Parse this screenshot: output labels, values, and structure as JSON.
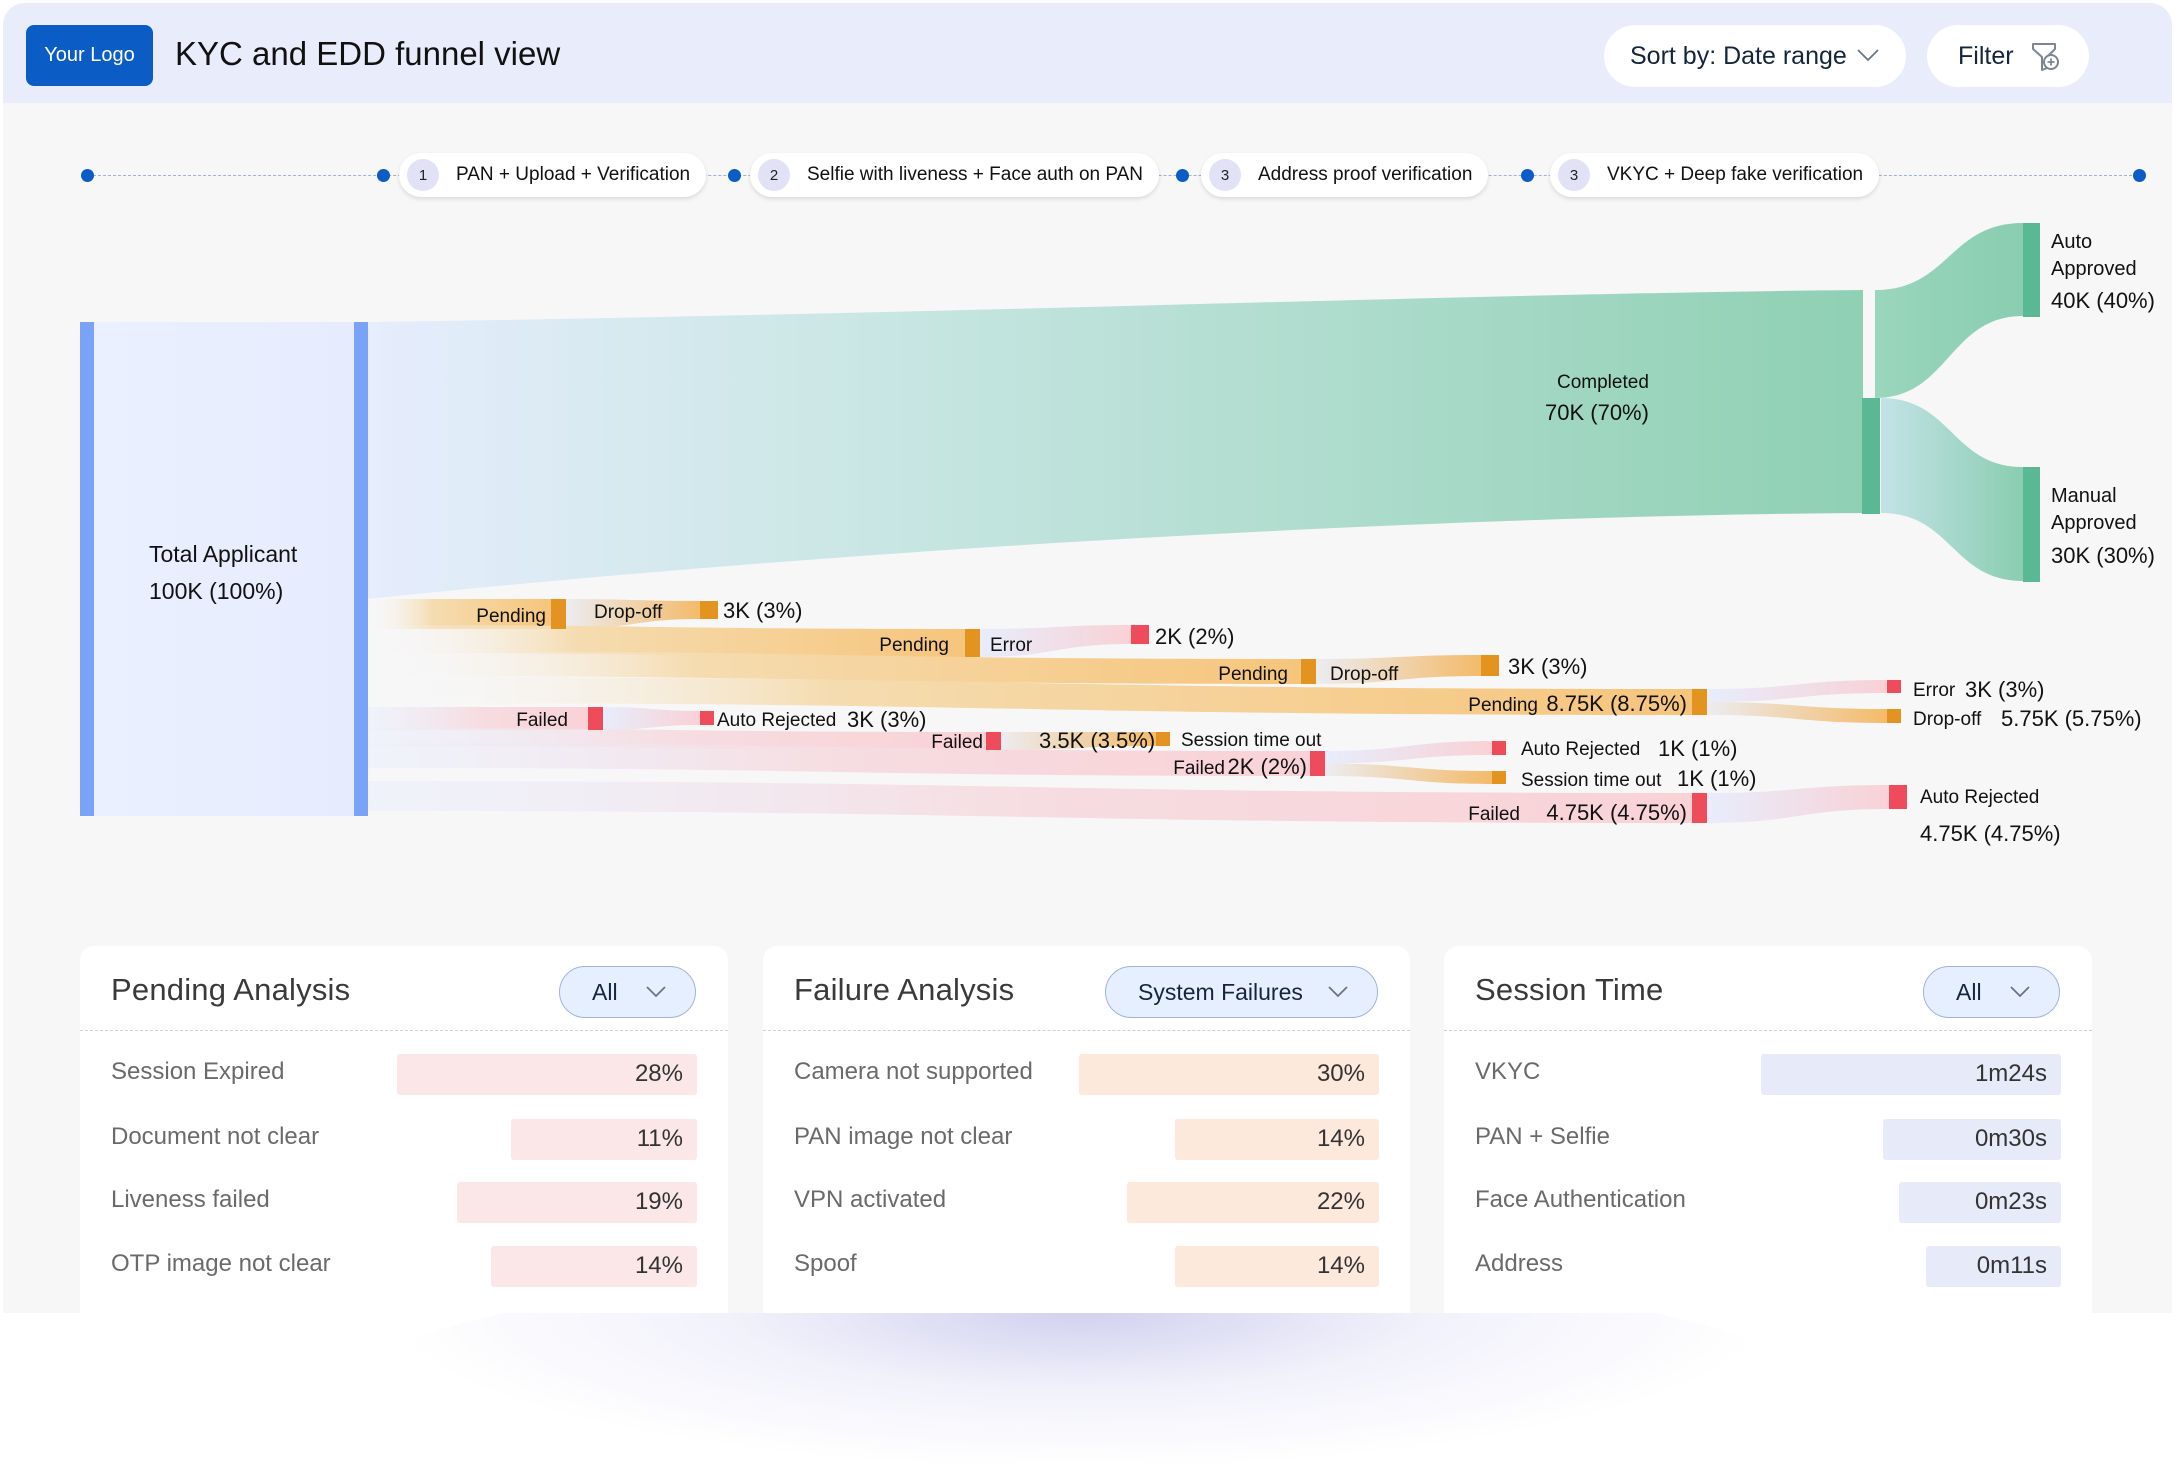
{
  "header": {
    "logo_text": "Your Logo",
    "title": "KYC and EDD funnel view",
    "sort_label": "Sort by: Date range",
    "filter_label": "Filter",
    "icons": {
      "sort": "chevron-down-icon",
      "filter": "filter-add-icon"
    }
  },
  "steps": [
    {
      "num": "1",
      "label": "PAN + Upload + Verification"
    },
    {
      "num": "2",
      "label": "Selfie with liveness + Face auth on PAN"
    },
    {
      "num": "3",
      "label": "Address proof verification"
    },
    {
      "num": "3",
      "label": "VKYC + Deep fake verification"
    }
  ],
  "colors": {
    "brand": "#0b5cc4",
    "total_node": "#7aa2f7",
    "completed": "#5bb894",
    "pending": "#e39320",
    "failed": "#ee4c5a",
    "pending_bar_bg": "#fbe7e7",
    "failure_bar_bg": "#fde8dc",
    "session_bar_bg": "#e6eaf9"
  },
  "chart_data": {
    "type": "sankey",
    "title": "KYC and EDD funnel view",
    "units": "applicants",
    "nodes": [
      {
        "id": "total",
        "label": "Total Applicant",
        "value_label": "100K (100%)",
        "value": 100000
      },
      {
        "id": "completed",
        "label": "Completed",
        "value_label": "70K (70%)",
        "value": 70000
      },
      {
        "id": "auto_approved",
        "label": "Auto Approved",
        "value_label": "40K (40%)",
        "value": 40000
      },
      {
        "id": "manual_approved",
        "label": "Manual Approved",
        "value_label": "30K (30%)",
        "value": 30000
      },
      {
        "id": "pending_s1",
        "label": "Pending",
        "stage": 1
      },
      {
        "id": "dropoff_s1",
        "label": "Drop-off",
        "value_label": "3K (3%)",
        "value": 3000
      },
      {
        "id": "pending_s2",
        "label": "Pending",
        "stage": 2
      },
      {
        "id": "error_s2",
        "label": "Error",
        "value_label": "2K (2%)",
        "value": 2000
      },
      {
        "id": "pending_s3",
        "label": "Pending",
        "stage": 3
      },
      {
        "id": "dropoff_s3",
        "label": "Drop-off",
        "value_label": "3K (3%)",
        "value": 3000
      },
      {
        "id": "pending_s4",
        "label": "Pending",
        "value_label": "8.75K (8.75%)",
        "value": 8750,
        "stage": 4
      },
      {
        "id": "error_s4",
        "label": "Error",
        "value_label": "3K (3%)",
        "value": 3000
      },
      {
        "id": "dropoff_s4",
        "label": "Drop-off",
        "value_label": "5.75K (5.75%)",
        "value": 5750
      },
      {
        "id": "failed_s1",
        "label": "Failed",
        "stage": 1
      },
      {
        "id": "autorej_s1",
        "label": "Auto Rejected",
        "value_label": "3K (3%)",
        "value": 3000
      },
      {
        "id": "failed_s2",
        "label": "Failed",
        "stage": 2
      },
      {
        "id": "timeout_s2",
        "label": "Session time out",
        "value_label": "3.5K (3.5%)",
        "value": 3500
      },
      {
        "id": "failed_s3",
        "label": "Failed",
        "value_label": "2K (2%)",
        "value": 2000,
        "stage": 3
      },
      {
        "id": "autorej_s3",
        "label": "Auto Rejected",
        "value_label": "1K (1%)",
        "value": 1000
      },
      {
        "id": "timeout_s3",
        "label": "Session time out",
        "value_label": "1K (1%)",
        "value": 1000
      },
      {
        "id": "failed_s4",
        "label": "Failed",
        "value_label": "4.75K (4.75%)",
        "value": 4750,
        "stage": 4
      },
      {
        "id": "autorej_s4",
        "label": "Auto Rejected",
        "value_label": "4.75K (4.75%)",
        "value": 4750
      }
    ],
    "links": [
      {
        "source": "total",
        "target": "completed",
        "value": 70000
      },
      {
        "source": "completed",
        "target": "auto_approved",
        "value": 40000
      },
      {
        "source": "completed",
        "target": "manual_approved",
        "value": 30000
      },
      {
        "source": "total",
        "target": "pending_s1",
        "value": 3000
      },
      {
        "source": "pending_s1",
        "target": "dropoff_s1",
        "value": 3000
      },
      {
        "source": "total",
        "target": "pending_s2",
        "value": 2000
      },
      {
        "source": "pending_s2",
        "target": "error_s2",
        "value": 2000
      },
      {
        "source": "total",
        "target": "pending_s3",
        "value": 3000
      },
      {
        "source": "pending_s3",
        "target": "dropoff_s3",
        "value": 3000
      },
      {
        "source": "total",
        "target": "pending_s4",
        "value": 8750
      },
      {
        "source": "pending_s4",
        "target": "error_s4",
        "value": 3000
      },
      {
        "source": "pending_s4",
        "target": "dropoff_s4",
        "value": 5750
      },
      {
        "source": "total",
        "target": "failed_s1",
        "value": 3000
      },
      {
        "source": "failed_s1",
        "target": "autorej_s1",
        "value": 3000
      },
      {
        "source": "total",
        "target": "failed_s2",
        "value": 3500
      },
      {
        "source": "failed_s2",
        "target": "timeout_s2",
        "value": 3500
      },
      {
        "source": "total",
        "target": "failed_s3",
        "value": 2000
      },
      {
        "source": "failed_s3",
        "target": "autorej_s3",
        "value": 1000
      },
      {
        "source": "failed_s3",
        "target": "timeout_s3",
        "value": 1000
      },
      {
        "source": "total",
        "target": "failed_s4",
        "value": 4750
      },
      {
        "source": "failed_s4",
        "target": "autorej_s4",
        "value": 4750
      }
    ]
  },
  "cards": [
    {
      "title": "Pending Analysis",
      "dropdown": "All",
      "theme": "pending",
      "rows": [
        {
          "label": "Session Expired",
          "value": "28%",
          "share": 28
        },
        {
          "label": "Document not clear",
          "value": "11%",
          "share": 11
        },
        {
          "label": "Liveness failed",
          "value": "19%",
          "share": 19
        },
        {
          "label": "OTP image not clear",
          "value": "14%",
          "share": 14
        }
      ]
    },
    {
      "title": "Failure Analysis",
      "dropdown": "System Failures",
      "theme": "failure",
      "rows": [
        {
          "label": "Camera not supported",
          "value": "30%",
          "share": 30
        },
        {
          "label": "PAN image not clear",
          "value": "14%",
          "share": 14
        },
        {
          "label": "VPN activated",
          "value": "22%",
          "share": 22
        },
        {
          "label": "Spoof",
          "value": "14%",
          "share": 14
        }
      ]
    },
    {
      "title": "Session Time",
      "dropdown": "All",
      "theme": "session",
      "rows": [
        {
          "label": "VKYC",
          "value": "1m24s",
          "seconds": 84
        },
        {
          "label": "PAN + Selfie",
          "value": "0m30s",
          "seconds": 30
        },
        {
          "label": "Face Authentication",
          "value": "0m23s",
          "seconds": 23
        },
        {
          "label": "Address",
          "value": "0m11s",
          "seconds": 11
        }
      ]
    }
  ]
}
